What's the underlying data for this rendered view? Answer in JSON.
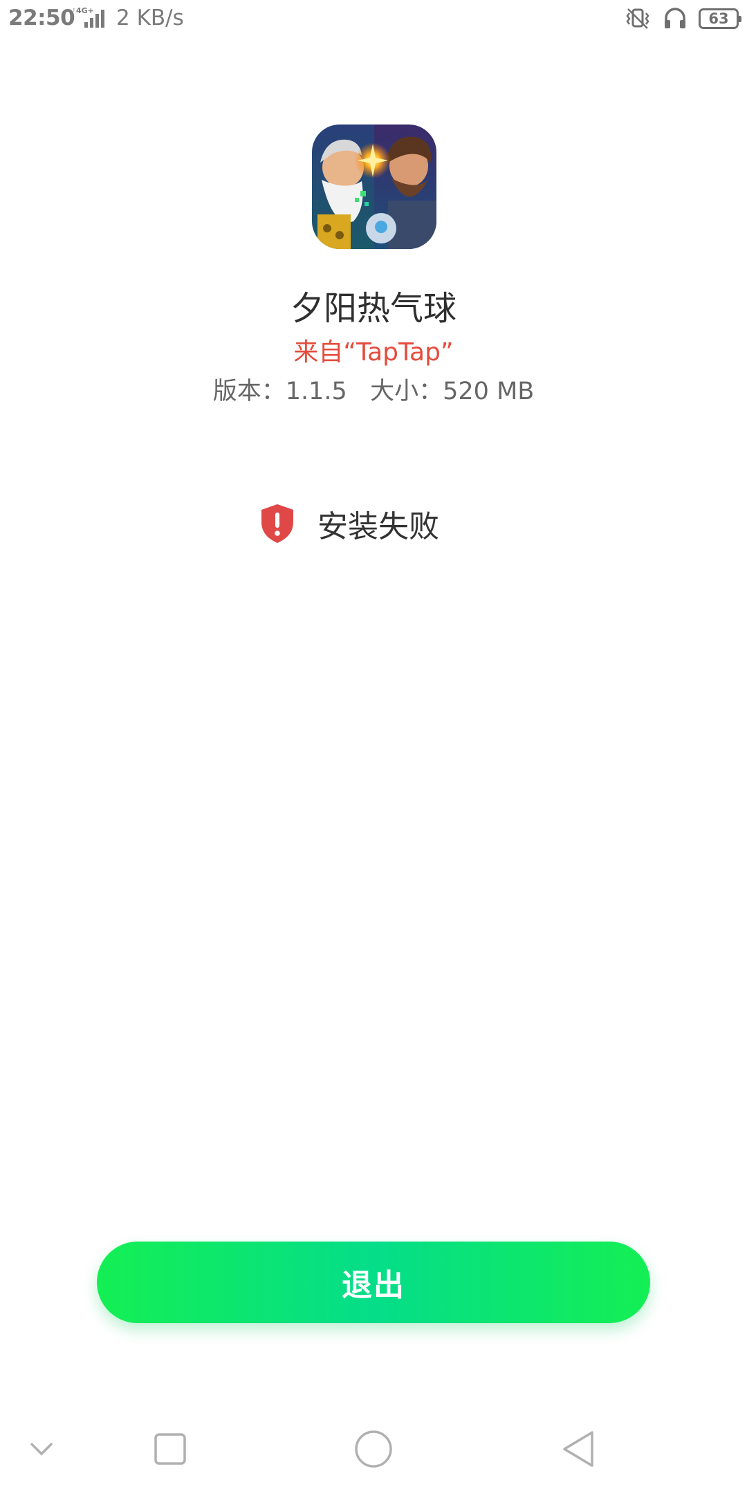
{
  "status_bar": {
    "time": "22:50",
    "network": "4G+",
    "speed": "2 KB/s",
    "battery": "63",
    "icons": [
      "signal-icon",
      "vibrate-icon",
      "headset-icon",
      "battery-icon"
    ]
  },
  "app": {
    "icon_name": "app-icon",
    "name": "夕阳热气球",
    "source": "来自“TapTap”",
    "meta": "版本：1.1.5   大小：520 MB"
  },
  "install": {
    "status_icon": "shield-alert-icon",
    "status_text": "安装失败",
    "status_color": "#e04848"
  },
  "actions": {
    "exit_label": "退出",
    "accent_start": "#14ef54",
    "accent_mid": "#05dd8a"
  },
  "nav_bar": {
    "buttons": [
      "nav-collapse-icon",
      "recents-icon",
      "home-icon",
      "back-icon"
    ]
  }
}
